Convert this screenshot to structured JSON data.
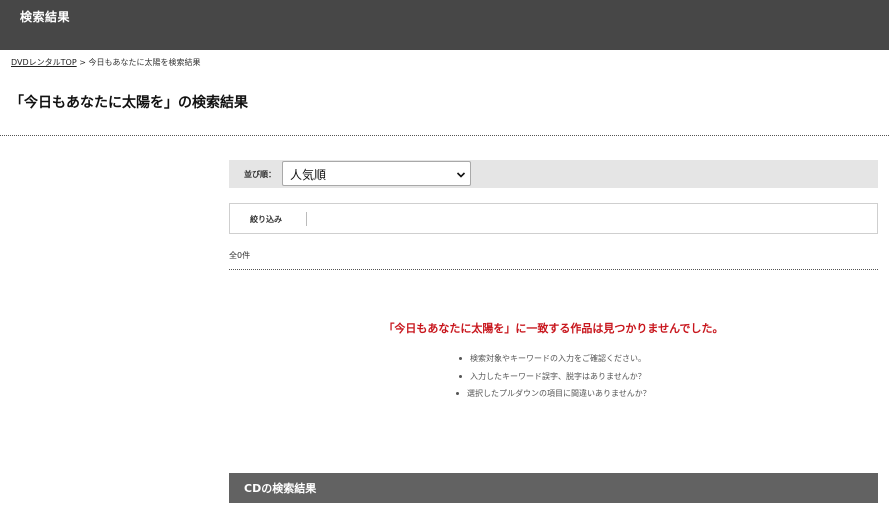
{
  "header": {
    "title": "検索結果"
  },
  "breadcrumb": {
    "home_link": "DVDレンタルTOP",
    "separator": ">",
    "current": "今日もあなたに太陽を検索結果"
  },
  "page_title": "「今日もあなたに太陽を」の検索結果",
  "sort": {
    "label": "並び順：",
    "selected": "人気順",
    "icon": "chevron-down-icon"
  },
  "filter": {
    "label": "絞り込み"
  },
  "results": {
    "count_text": "全0件"
  },
  "no_results": {
    "message": "「今日もあなたに太陽を」に一致する作品は見つかりませんでした。",
    "tips": [
      "検索対象やキーワードの入力をご確認ください。",
      "入力したキーワード誤字、脱字はありませんか？",
      "選択したプルダウンの項目に間違いありませんか？"
    ]
  },
  "cd_section": {
    "title": "CDの検索結果"
  },
  "colors": {
    "header_bg": "#474747",
    "error_red": "#c8161d",
    "section_bar_bg": "#626262",
    "sort_bar_bg": "#e5e5e5"
  }
}
